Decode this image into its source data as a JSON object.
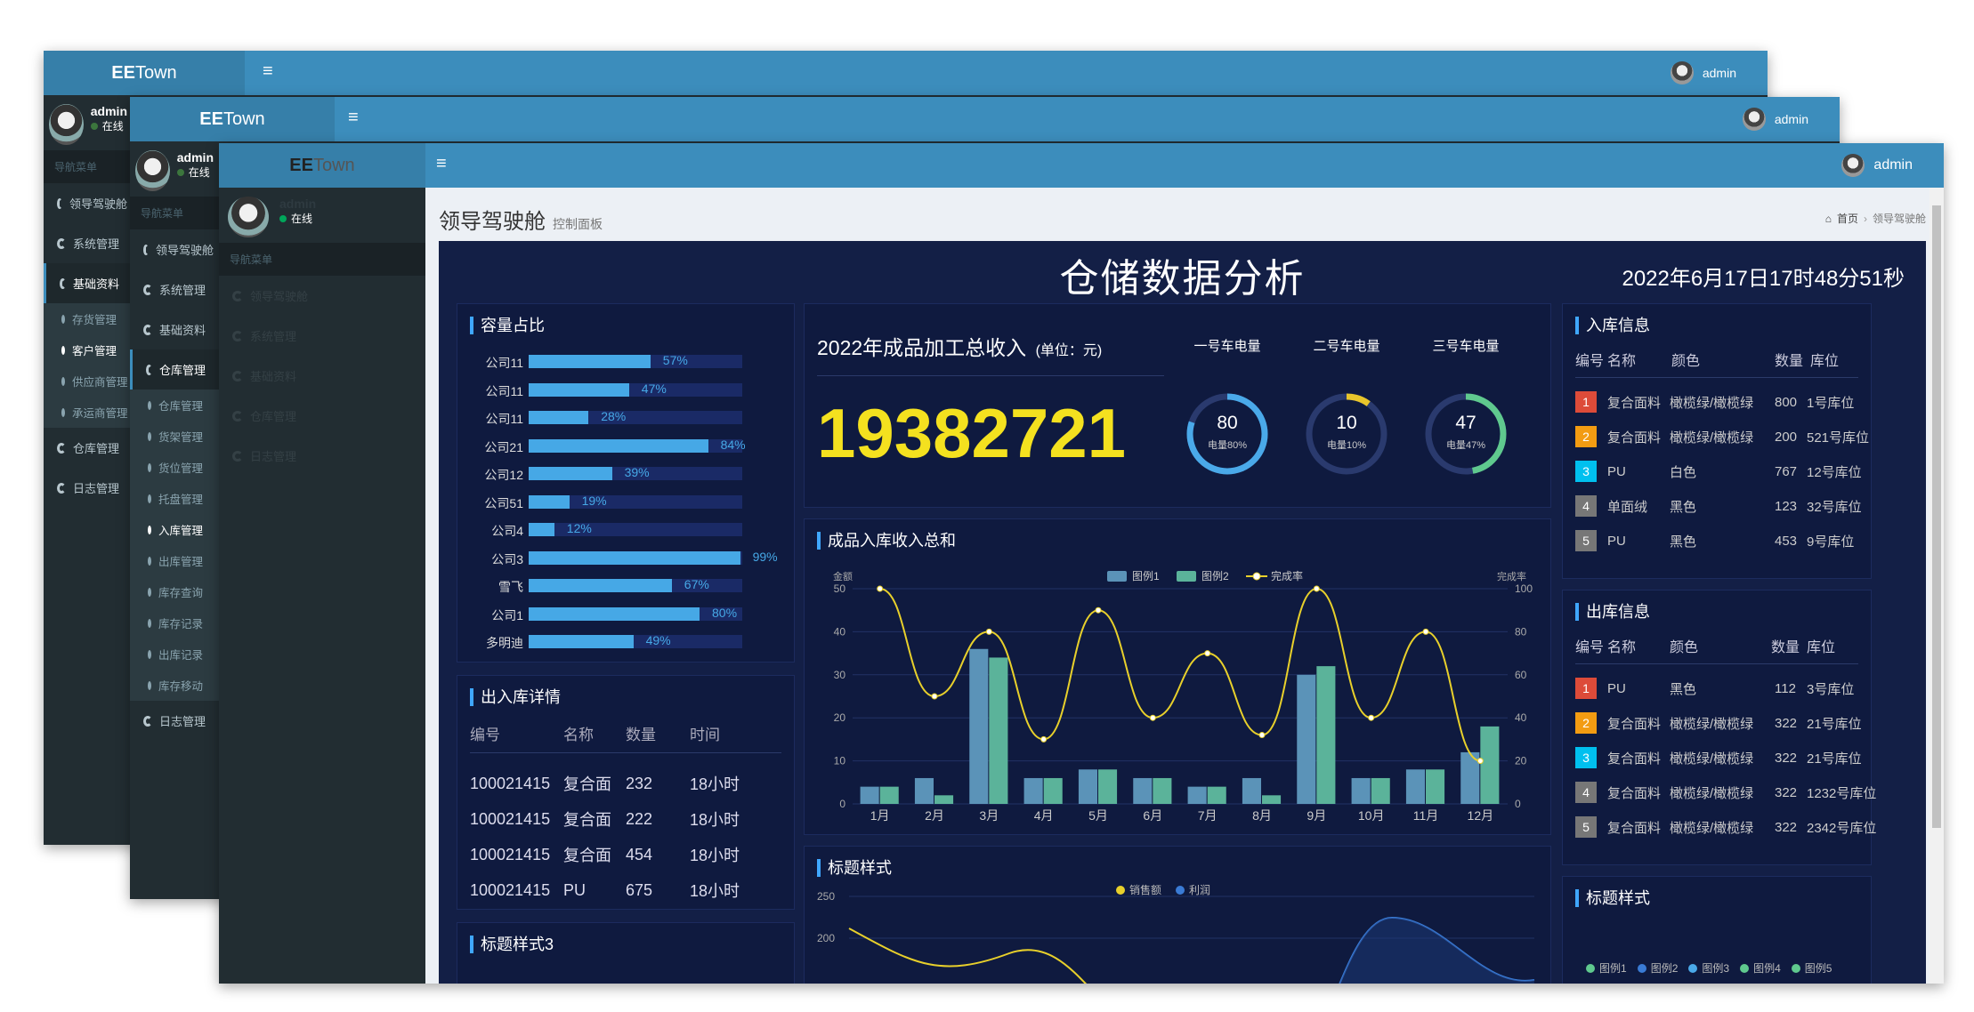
{
  "brand": {
    "bold": "EE",
    "rest": "Town"
  },
  "menu_toggle": "≡",
  "user": {
    "name": "admin",
    "status": "在线"
  },
  "nav": {
    "header": "导航菜单",
    "items": [
      "领导驾驶舱",
      "系统管理",
      "基础资料",
      "仓库管理",
      "日志管理"
    ],
    "w1_sub": [
      "存货管理",
      "客户管理",
      "供应商管理",
      "承运商管理"
    ],
    "w1_main": [
      "仓库管理",
      "日志管理"
    ],
    "w2_sub": [
      "仓库管理",
      "货架管理",
      "货位管理",
      "托盘管理",
      "入库管理",
      "出库管理",
      "库存查询",
      "库存记录",
      "出库记录",
      "库存移动"
    ],
    "w3_faded": [
      "领导驾驶舱",
      "系统管理",
      "基础资料",
      "仓库管理",
      "日志管理"
    ]
  },
  "page": {
    "title": "领导驾驶舱",
    "subtitle": "控制面板"
  },
  "breadcrumb": {
    "home": "首页",
    "sep": "›",
    "current": "领导驾驶舱"
  },
  "dashboard": {
    "title": "仓储数据分析",
    "datetime": "2022年6月17日17时48分51秒",
    "capacity": {
      "title": "容量占比",
      "items": [
        {
          "name": "公司11",
          "pct": 57,
          "label": "57%"
        },
        {
          "name": "公司11",
          "pct": 47,
          "label": "47%"
        },
        {
          "name": "公司11",
          "pct": 28,
          "label": "28%"
        },
        {
          "name": "公司21",
          "pct": 84,
          "label": "84%"
        },
        {
          "name": "公司12",
          "pct": 39,
          "label": "39%"
        },
        {
          "name": "公司51",
          "pct": 19,
          "label": "19%"
        },
        {
          "name": "公司4",
          "pct": 12,
          "label": "12%"
        },
        {
          "name": "公司3",
          "pct": 99,
          "label": "99%"
        },
        {
          "name": "雪飞",
          "pct": 67,
          "label": "67%"
        },
        {
          "name": "公司1",
          "pct": 80,
          "label": "80%"
        },
        {
          "name": "多明迪",
          "pct": 49,
          "label": "49%"
        }
      ]
    },
    "revenue": {
      "title": "2022年成品加工总收入",
      "unit": "(单位：元)",
      "value": "19382721"
    },
    "gauges": [
      {
        "name": "一号车电量",
        "value": "80",
        "sub": "电量80%",
        "pct": 80,
        "color": "#4aa9e9"
      },
      {
        "name": "二号车电量",
        "value": "10",
        "sub": "电量10%",
        "pct": 10,
        "color": "#e8c52b"
      },
      {
        "name": "三号车电量",
        "value": "47",
        "sub": "电量47%",
        "pct": 47,
        "color": "#5fc98e"
      }
    ],
    "inbound": {
      "title": "入库信息",
      "headers": [
        "编号",
        "名称",
        "颜色",
        "数量",
        "库位"
      ],
      "rows": [
        {
          "no": "1",
          "color": "#dd4b39",
          "name": "复合面料",
          "colour": "橄榄绿/橄榄绿",
          "qty": "800",
          "loc": "1号库位"
        },
        {
          "no": "2",
          "color": "#f39c12",
          "name": "复合面料",
          "colour": "橄榄绿/橄榄绿",
          "qty": "200",
          "loc": "521号库位"
        },
        {
          "no": "3",
          "color": "#00c0ef",
          "name": "PU",
          "colour": "白色",
          "qty": "767",
          "loc": "12号库位"
        },
        {
          "no": "4",
          "color": "#777777",
          "name": "单面绒",
          "colour": "黑色",
          "qty": "123",
          "loc": "32号库位"
        },
        {
          "no": "5",
          "color": "#777777",
          "name": "PU",
          "colour": "黑色",
          "qty": "453",
          "loc": "9号库位"
        }
      ]
    },
    "outbound": {
      "title": "出库信息",
      "headers": [
        "编号",
        "名称",
        "颜色",
        "数量",
        "库位"
      ],
      "rows": [
        {
          "no": "1",
          "color": "#dd4b39",
          "name": "PU",
          "colour": "黑色",
          "qty": "112",
          "loc": "3号库位"
        },
        {
          "no": "2",
          "color": "#f39c12",
          "name": "复合面料",
          "colour": "橄榄绿/橄榄绿",
          "qty": "322",
          "loc": "21号库位"
        },
        {
          "no": "3",
          "color": "#00c0ef",
          "name": "复合面料",
          "colour": "橄榄绿/橄榄绿",
          "qty": "322",
          "loc": "21号库位"
        },
        {
          "no": "4",
          "color": "#777777",
          "name": "复合面料",
          "colour": "橄榄绿/橄榄绿",
          "qty": "322",
          "loc": "1232号库位"
        },
        {
          "no": "5",
          "color": "#777777",
          "name": "复合面料",
          "colour": "橄榄绿/橄榄绿",
          "qty": "322",
          "loc": "2342号库位"
        }
      ]
    },
    "io_detail": {
      "title": "出入库详情",
      "headers": [
        "编号",
        "名称",
        "数量",
        "时间"
      ],
      "rows": [
        {
          "id": "100021415",
          "name": "复合面",
          "qty": "232",
          "time": "18小时"
        },
        {
          "id": "100021415",
          "name": "复合面",
          "qty": "222",
          "time": "18小时"
        },
        {
          "id": "100021415",
          "name": "复合面",
          "qty": "454",
          "time": "18小时"
        },
        {
          "id": "100021415",
          "name": "PU",
          "qty": "675",
          "time": "18小时"
        }
      ]
    },
    "title_style_3": "标题样式3",
    "title_style_bottom": "标题样式",
    "title_style_right": "标题样式",
    "right_legend": [
      "图例1",
      "图例2",
      "图例3",
      "图例4",
      "图例5"
    ],
    "right_legend_colors": [
      "#5fc98e",
      "#3a7bd5",
      "#4aa9e9",
      "#5fc98e",
      "#5fc98e"
    ],
    "bottom_legend": [
      "销售额",
      "利润"
    ]
  },
  "chart_data": {
    "type": "bar",
    "title": "成品入库收入总和",
    "categories": [
      "1月",
      "2月",
      "3月",
      "4月",
      "5月",
      "6月",
      "7月",
      "8月",
      "9月",
      "10月",
      "11月",
      "12月"
    ],
    "ylabel": "金额",
    "y2label": "完成率",
    "ylim": [
      0,
      50
    ],
    "y2lim": [
      0,
      100
    ],
    "yticks": [
      "50",
      "40",
      "30",
      "20",
      "10",
      "0"
    ],
    "y2ticks": [
      "100",
      "80",
      "60",
      "40",
      "20",
      "0"
    ],
    "legend_position": "top-center",
    "grid": true,
    "series": [
      {
        "name": "图例1",
        "type": "bar",
        "color": "#5b93b8",
        "values": [
          4,
          6,
          36,
          6,
          8,
          6,
          4,
          6,
          30,
          6,
          8,
          12
        ]
      },
      {
        "name": "图例2",
        "type": "bar",
        "color": "#5bb39a",
        "values": [
          4,
          2,
          34,
          6,
          8,
          6,
          4,
          2,
          32,
          6,
          8,
          18
        ]
      },
      {
        "name": "完成率",
        "type": "line",
        "axis": "right",
        "color": "#e8d02b",
        "values": [
          100,
          50,
          80,
          30,
          90,
          40,
          70,
          32,
          100,
          40,
          80,
          20
        ]
      }
    ]
  }
}
